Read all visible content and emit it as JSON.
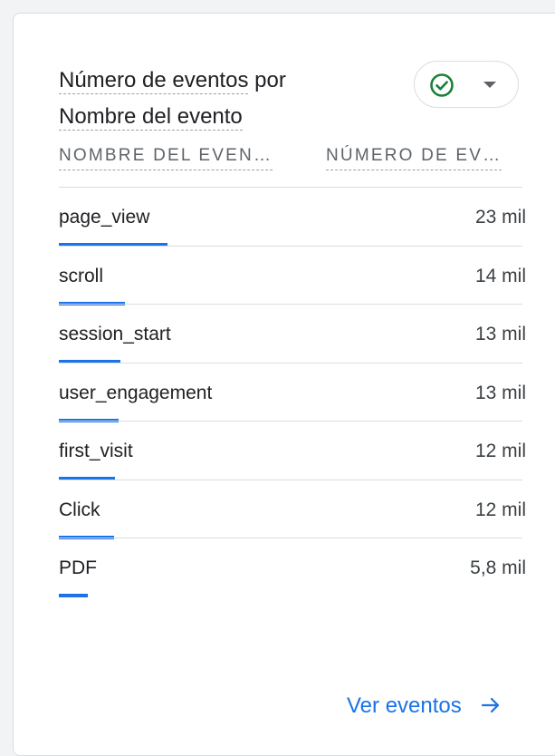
{
  "card": {
    "title_part1": "Número de eventos",
    "title_part2": "por",
    "title_part3": "Nombre del evento",
    "status_icon": "check-circle-icon",
    "columns": {
      "name": "NOMBRE DEL EVEN…",
      "count": "NÚMERO DE EV…"
    },
    "rows": [
      {
        "name": "page_view",
        "value": "23 mil",
        "share": 1.0
      },
      {
        "name": "scroll",
        "value": "14 mil",
        "share": 0.61
      },
      {
        "name": "session_start",
        "value": "13 mil",
        "share": 0.57
      },
      {
        "name": "user_engagement",
        "value": "13 mil",
        "share": 0.55
      },
      {
        "name": "first_visit",
        "value": "12 mil",
        "share": 0.52
      },
      {
        "name": "Click",
        "value": "12 mil",
        "share": 0.51
      },
      {
        "name": "PDF",
        "value": "5,8 mil",
        "share": 0.27
      }
    ],
    "link_label": "Ver eventos",
    "colors": {
      "accent": "#1a73e8",
      "success": "#188038"
    }
  }
}
